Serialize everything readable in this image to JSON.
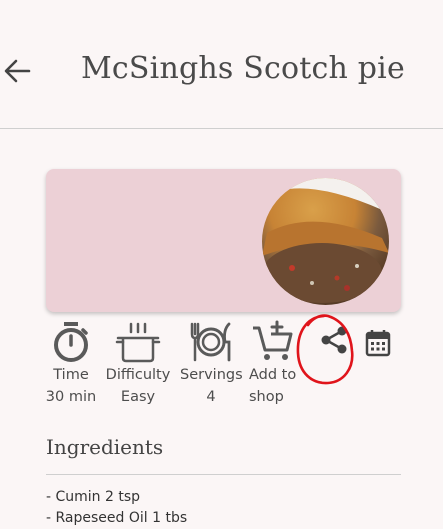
{
  "header": {
    "title": "McSinghs Scotch pie",
    "back_icon": "arrow-left-icon"
  },
  "hero": {
    "image_desc_icon": "pie-photo"
  },
  "actions": {
    "time": {
      "label": "Time",
      "value": "30 min",
      "icon": "timer-icon"
    },
    "difficulty": {
      "label": "Difficulty",
      "value": "Easy",
      "icon": "pot-icon"
    },
    "servings": {
      "label": "Servings",
      "value": "4",
      "icon": "plate-cutlery-icon"
    },
    "shop": {
      "label": "Add to",
      "label2": "shop",
      "icon": "cart-add-icon"
    },
    "share": {
      "icon": "share-icon"
    },
    "calendar": {
      "icon": "calendar-icon"
    }
  },
  "ingredients": {
    "heading": "Ingredients",
    "items": [
      "- Cumin 2 tsp",
      "- Rapeseed Oil 1 tbs"
    ]
  },
  "colors": {
    "background": "#fbf6f6",
    "card": "#ecd0d6",
    "annotation": "#e0141b",
    "icon": "#5a5a5a"
  }
}
